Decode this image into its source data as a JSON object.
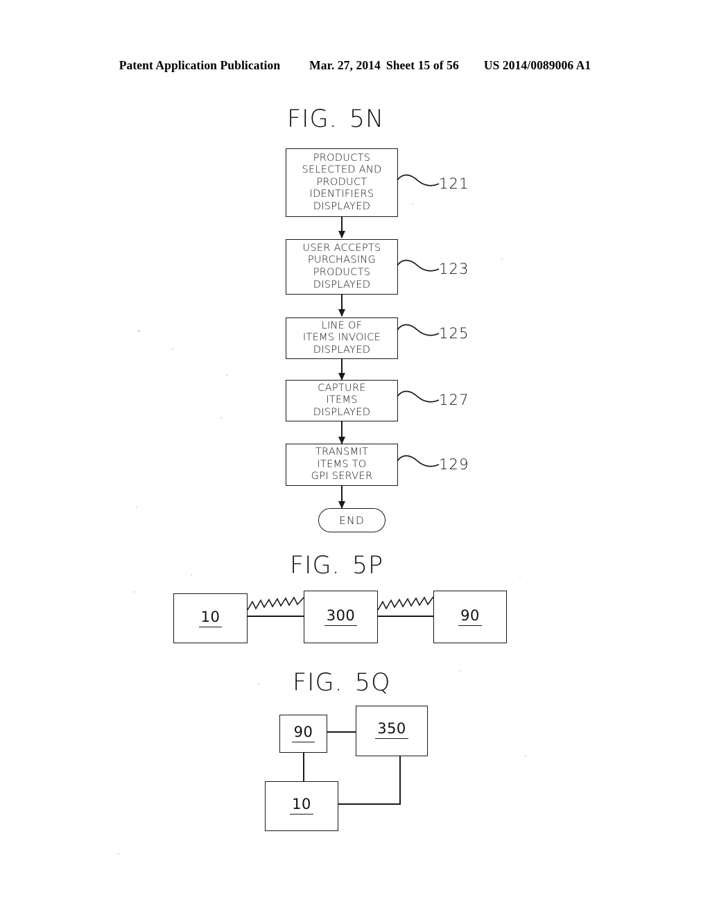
{
  "header": {
    "publication": "Patent Application Publication",
    "date": "Mar. 27, 2014",
    "sheet": "Sheet 15 of 56",
    "patent_number": "US 2014/0089006 A1"
  },
  "figures": [
    {
      "id": "fig-5n",
      "title_prefix": "FIG.",
      "title_suffix": "5N",
      "type": "flowchart",
      "steps": [
        {
          "ref": "121",
          "lines": [
            "PRODUCTS",
            "SELECTED  AND",
            "PRODUCT",
            "IDENTIFIERS",
            "DISPLAYED"
          ]
        },
        {
          "ref": "123",
          "lines": [
            "USER  ACCEPTS",
            "PURCHASING",
            "PRODUCTS",
            "DISPLAYED"
          ]
        },
        {
          "ref": "125",
          "lines": [
            "LINE  OF",
            "ITEMS  INVOICE",
            "DISPLAYED"
          ]
        },
        {
          "ref": "127",
          "lines": [
            "CAPTURE",
            "ITEMS",
            "DISPLAYED"
          ]
        },
        {
          "ref": "129",
          "lines": [
            "TRANSMIT",
            "ITEMS  TO",
            "GPI  SERVER"
          ]
        }
      ],
      "terminator": "END"
    },
    {
      "id": "fig-5p",
      "title_prefix": "FIG.",
      "title_suffix": "5P",
      "type": "block-diagram",
      "blocks": [
        {
          "label": "10"
        },
        {
          "label": "300"
        },
        {
          "label": "90"
        }
      ],
      "connectors": [
        {
          "from": "10",
          "to": "300",
          "style": "broken-zigzag"
        },
        {
          "from": "300",
          "to": "90",
          "style": "broken-zigzag"
        }
      ]
    },
    {
      "id": "fig-5q",
      "title_prefix": "FIG.",
      "title_suffix": "5Q",
      "type": "block-diagram",
      "blocks": [
        {
          "label": "90"
        },
        {
          "label": "350"
        },
        {
          "label": "10"
        }
      ],
      "connectors": [
        {
          "from": "90",
          "to": "350",
          "style": "solid"
        },
        {
          "from": "90",
          "to": "10",
          "style": "solid"
        },
        {
          "from": "350",
          "to": "10",
          "style": "solid"
        }
      ]
    }
  ],
  "colors": {
    "ink": "#1a1a1a",
    "paper": "#ffffff"
  }
}
